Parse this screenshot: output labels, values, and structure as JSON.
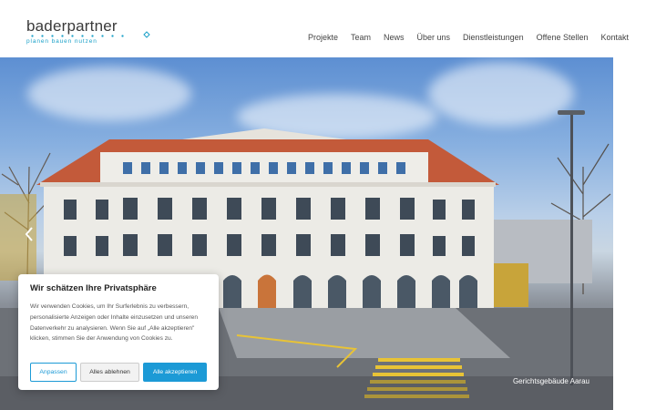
{
  "header": {
    "logo_text": "baderpartner",
    "logo_tagline": "planen bauen nutzen",
    "nav": [
      "Projekte",
      "Team",
      "News",
      "Über uns",
      "Dienstleistungen",
      "Offene Stellen",
      "Kontakt"
    ]
  },
  "hero": {
    "caption": "Gerichtsgebäude Aarau",
    "image_subject": "building-photo"
  },
  "cookie_banner": {
    "title": "Wir schätzen Ihre Privatsphäre",
    "text": "Wir verwenden Cookies, um Ihr Surferlebnis zu verbessern, personalisierte Anzeigen oder Inhalte einzusetzen und unseren Datenverkehr zu analysieren. Wenn Sie auf „Alle akzeptieren\" klicken, stimmen Sie der Anwendung von Cookies zu.",
    "btn_customize": "Anpassen",
    "btn_reject": "Alles ablehnen",
    "btn_accept": "Alle akzeptieren"
  },
  "colors": {
    "accent": "#1c9ad6",
    "logo_accent": "#1aa0c8",
    "roof": "#c85a3a"
  }
}
